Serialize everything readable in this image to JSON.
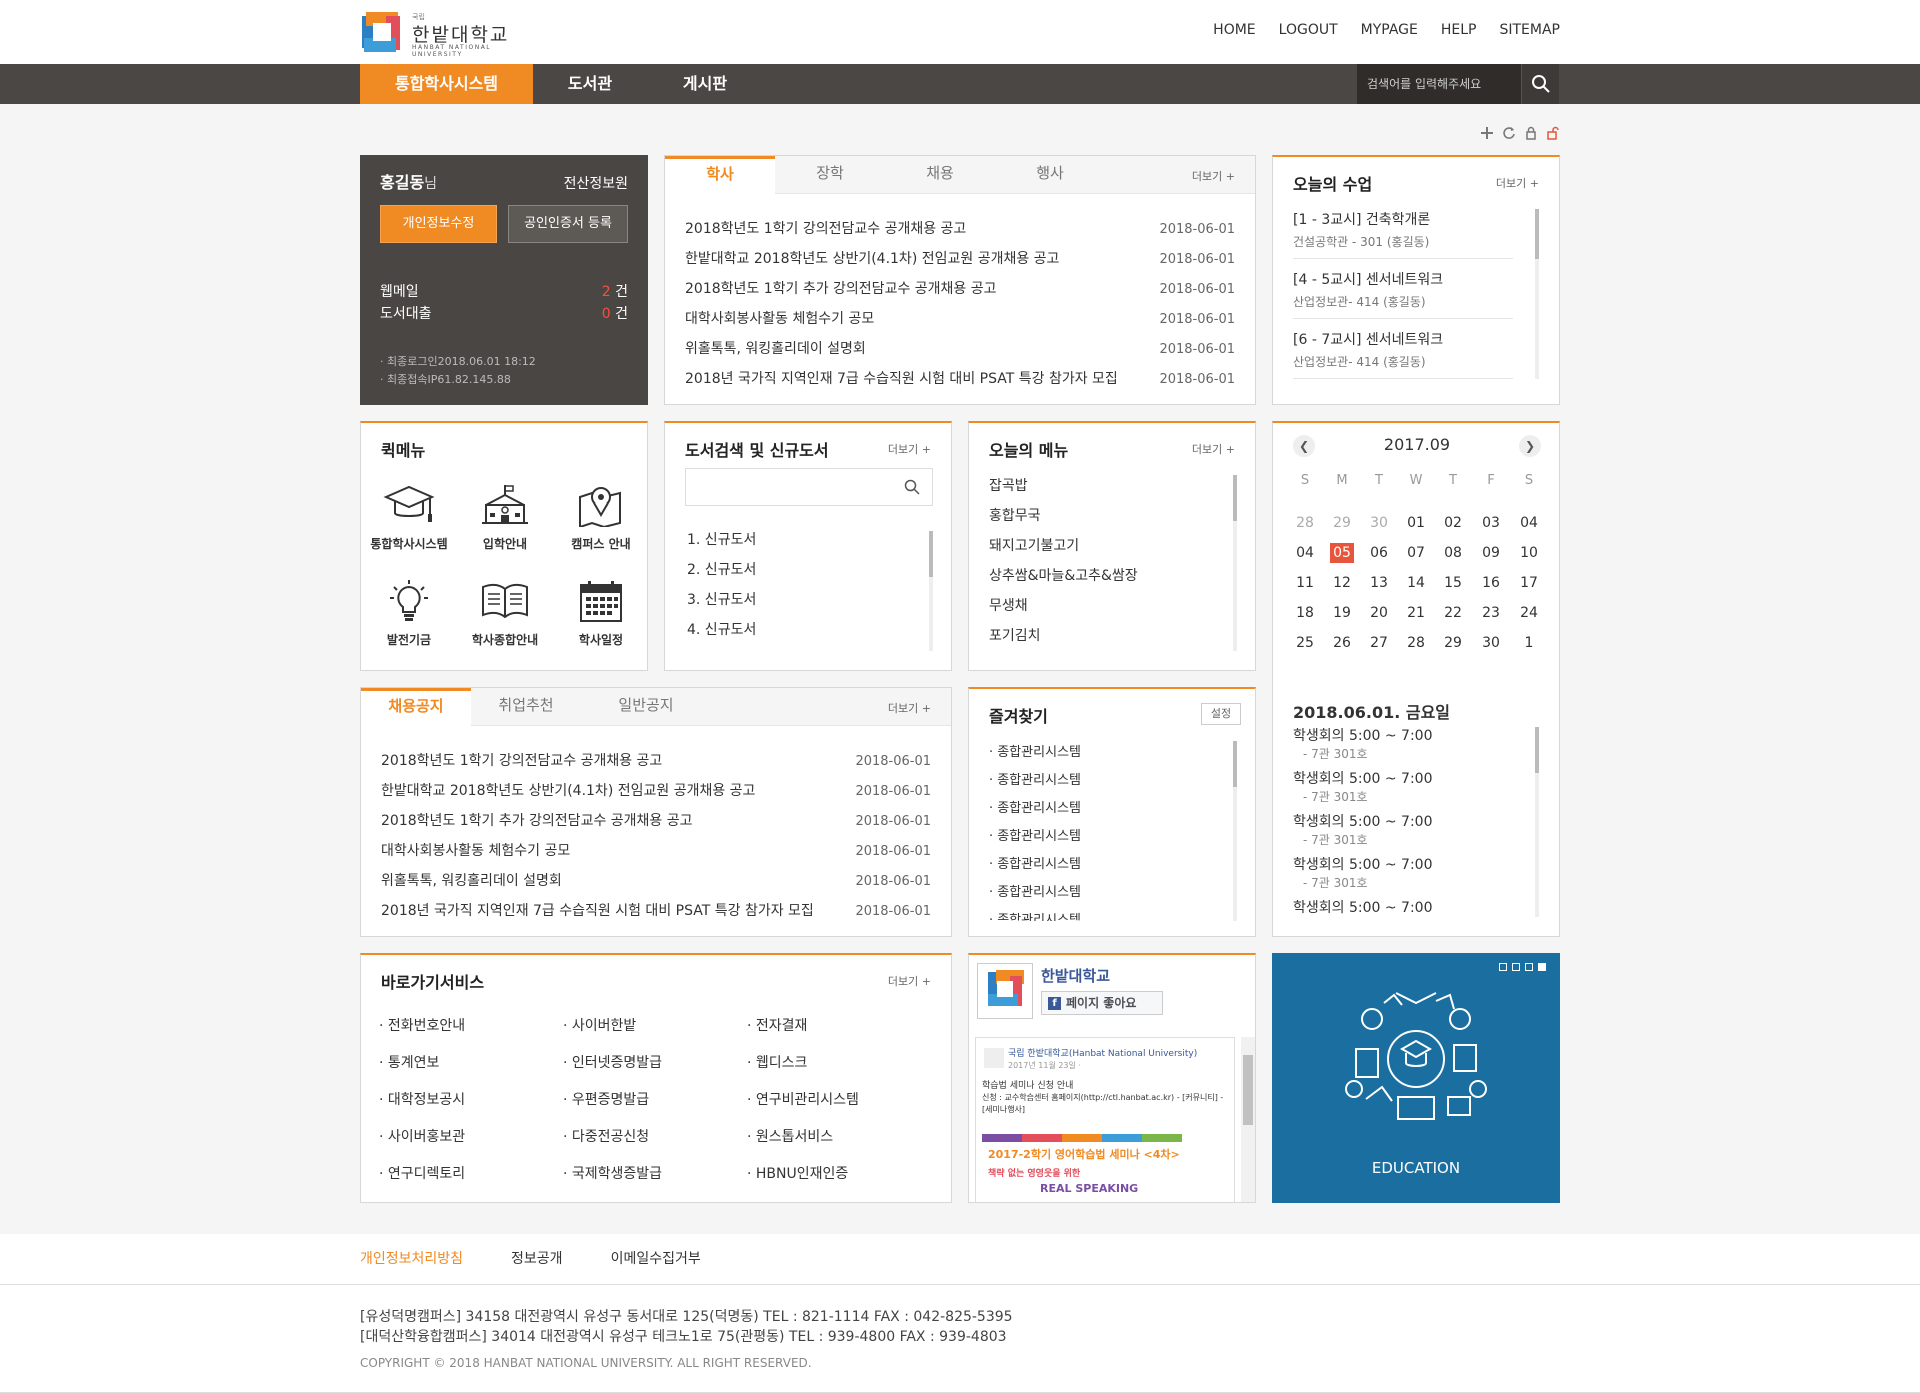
{
  "header": {
    "logo_small": "국립",
    "logo_text": "한밭대학교",
    "logo_sub": "HANBAT NATIONAL UNIVERSITY",
    "util_nav": [
      "HOME",
      "LOGOUT",
      "MYPAGE",
      "HELP",
      "SITEMAP"
    ]
  },
  "gnb": {
    "items": [
      "통합학사시스템",
      "도서관",
      "게시판"
    ],
    "search_placeholder": "검색어를 입력해주세요"
  },
  "profile": {
    "name": "홍길동",
    "honorific": "님",
    "dept": "전산정보원",
    "btn_edit": "개인정보수정",
    "btn_cert": "공인인증서 등록",
    "webmail_label": "웹메일",
    "webmail_count": "2",
    "loan_label": "도서대출",
    "loan_count": "0",
    "unit": "건",
    "last_login": "· 최종로그인2018.06.01 18:12",
    "last_ip": "· 최종접속IP61.82.145.88"
  },
  "notice": {
    "tabs": [
      "학사",
      "장학",
      "채용",
      "행사"
    ],
    "more": "더보기 +",
    "items": [
      {
        "title": "2018학년도 1학기 강의전담교수 공개채용 공고",
        "date": "2018-06-01"
      },
      {
        "title": "한밭대학교 2018학년도 상반기(4.1차) 전임교원 공개채용 공고",
        "date": "2018-06-01"
      },
      {
        "title": "2018학년도 1학기 추가 강의전담교수 공개채용 공고",
        "date": "2018-06-01"
      },
      {
        "title": "대학사회봉사활동 체험수기 공모",
        "date": "2018-06-01"
      },
      {
        "title": "위홀톡톡, 워킹홀리데이 설명회",
        "date": "2018-06-01"
      },
      {
        "title": "2018년 국가직 지역인재 7급 수습직원 시험 대비 PSAT 특강 참가자 모집",
        "date": "2018-06-01"
      }
    ]
  },
  "classes": {
    "title": "오늘의 수업",
    "more": "더보기 +",
    "items": [
      {
        "title": "[1 - 3교시] 건축학개론",
        "sub": "건설공학관 - 301 (홍길동)"
      },
      {
        "title": "[4 - 5교시] 센서네트워크",
        "sub": "산업정보관- 414 (홍길동)"
      },
      {
        "title": "[6 - 7교시] 센서네트워크",
        "sub": "산업정보관- 414 (홍길동)"
      }
    ]
  },
  "quick": {
    "title": "퀵메뉴",
    "items": [
      {
        "label": "통합학사시스템",
        "icon": "graduation-cap-icon"
      },
      {
        "label": "입학안내",
        "icon": "school-building-icon"
      },
      {
        "label": "캠퍼스 안내",
        "icon": "map-pin-icon"
      },
      {
        "label": "발전기금",
        "icon": "lightbulb-icon"
      },
      {
        "label": "학사종합안내",
        "icon": "open-book-icon"
      },
      {
        "label": "학사일정",
        "icon": "calendar-icon"
      }
    ]
  },
  "library": {
    "title": "도서검색 및 신규도서",
    "more": "더보기 +",
    "items": [
      "1. 신규도서",
      "2. 신규도서",
      "3. 신규도서",
      "4. 신규도서"
    ]
  },
  "menu": {
    "title": "오늘의 메뉴",
    "more": "더보기 +",
    "items": [
      "잡곡밥",
      "홍합무국",
      "돼지고기불고기",
      "상추쌈&마늘&고추&쌈장",
      "무생채",
      "포기김치"
    ]
  },
  "calendar": {
    "month": "2017.09",
    "weekdays": [
      "S",
      "M",
      "T",
      "W",
      "T",
      "F",
      "S"
    ],
    "weeks": [
      [
        "28",
        "29",
        "30",
        "01",
        "02",
        "03",
        "04"
      ],
      [
        "04",
        "05",
        "06",
        "07",
        "08",
        "09",
        "10"
      ],
      [
        "11",
        "12",
        "13",
        "14",
        "15",
        "16",
        "17"
      ],
      [
        "18",
        "19",
        "20",
        "21",
        "22",
        "23",
        "24"
      ],
      [
        "25",
        "26",
        "27",
        "28",
        "29",
        "30",
        "1"
      ]
    ],
    "today": "05",
    "selected_date": "2018.06.01. 금요일",
    "events": [
      {
        "title": "학생회의 5:00 ~ 7:00",
        "place": "- 7관 301호"
      },
      {
        "title": "학생회의 5:00 ~ 7:00",
        "place": "- 7관 301호"
      },
      {
        "title": "학생회의 5:00 ~ 7:00",
        "place": "- 7관 301호"
      },
      {
        "title": "학생회의 5:00 ~ 7:00",
        "place": "- 7관 301호"
      },
      {
        "title": "학생회의 5:00 ~ 7:00",
        "place": ""
      }
    ]
  },
  "jobs": {
    "tabs": [
      "채용공지",
      "취업추천",
      "일반공지"
    ],
    "more": "더보기 +",
    "items": [
      {
        "title": "2018학년도 1학기 강의전담교수 공개채용 공고",
        "date": "2018-06-01"
      },
      {
        "title": "한밭대학교 2018학년도 상반기(4.1차) 전임교원 공개채용 공고",
        "date": "2018-06-01"
      },
      {
        "title": "2018학년도 1학기 추가 강의전담교수 공개채용 공고",
        "date": "2018-06-01"
      },
      {
        "title": "대학사회봉사활동 체험수기 공모",
        "date": "2018-06-01"
      },
      {
        "title": "위홀톡톡, 워킹홀리데이 설명회",
        "date": "2018-06-01"
      },
      {
        "title": "2018년 국가직 지역인재 7급 수습직원 시험 대비 PSAT 특강 참가자 모집",
        "date": "2018-06-01"
      }
    ]
  },
  "favorites": {
    "title": "즐겨찾기",
    "setting": "설정",
    "items": [
      "· 종합관리시스템",
      "· 종합관리시스템",
      "· 종합관리시스템",
      "· 종합관리시스템",
      "· 종합관리시스템",
      "· 종합관리시스템",
      "· 종합관리시스템"
    ]
  },
  "shortcuts": {
    "title": "바로가기서비스",
    "more": "더보기 +",
    "items": [
      "· 전화번호안내",
      "· 사이버한밭",
      "· 전자결재",
      "· 통계연보",
      "· 인터넷증명발급",
      "· 웹디스크",
      "· 대학정보공시",
      "· 우편증명발급",
      "· 연구비관리시스템",
      "· 사이버홍보관",
      "· 다중전공신청",
      "· 원스톱서비스",
      "· 연구디렉토리",
      "· 국제학생증발급",
      "· HBNU인재인증"
    ]
  },
  "facebook": {
    "name": "한밭대학교",
    "like": "페이지 좋아요",
    "post_author": "국립 한밭대학교(Hanbat National University)",
    "post_date": "2017년 11월 23일 ·",
    "post_line1": "학습법 세미나 신청 안내",
    "post_line2": "신청 : 교수학습센터 홈페이지(http://ctl.hanbat.ac.kr) - [커뮤니티] - [세미나행사]",
    "banner_title": "2017-2학기 영어학습법 세미나 <4차>",
    "banner_sub": "책략 없는 영영웃을 위한",
    "banner_tail": "REAL SPEAKING"
  },
  "education": {
    "label": "EDUCATION",
    "bg": "#1a6fa0"
  },
  "footer": {
    "links": [
      "개인정보처리방침",
      "정보공개",
      "이메일수집거부"
    ],
    "addr1": "[유성덕명캠퍼스] 34158 대전광역시 유성구 동서대로 125(덕명동) TEL : 821-1114 FAX : 042-825-5395",
    "addr2": "[대덕산학융합캠퍼스] 34014 대전광역시 유성구 테크노1로 75(관평동) TEL : 939-4800 FAX : 939-4803",
    "copyright": "COPYRIGHT © 2018 HANBAT NATIONAL UNIVERSITY. ALL RIGHT RESERVED."
  },
  "colors": {
    "accent": "#f08a23",
    "gnb": "#4a4744",
    "profile_bg": "#4a4643",
    "today": "#e8553d"
  }
}
